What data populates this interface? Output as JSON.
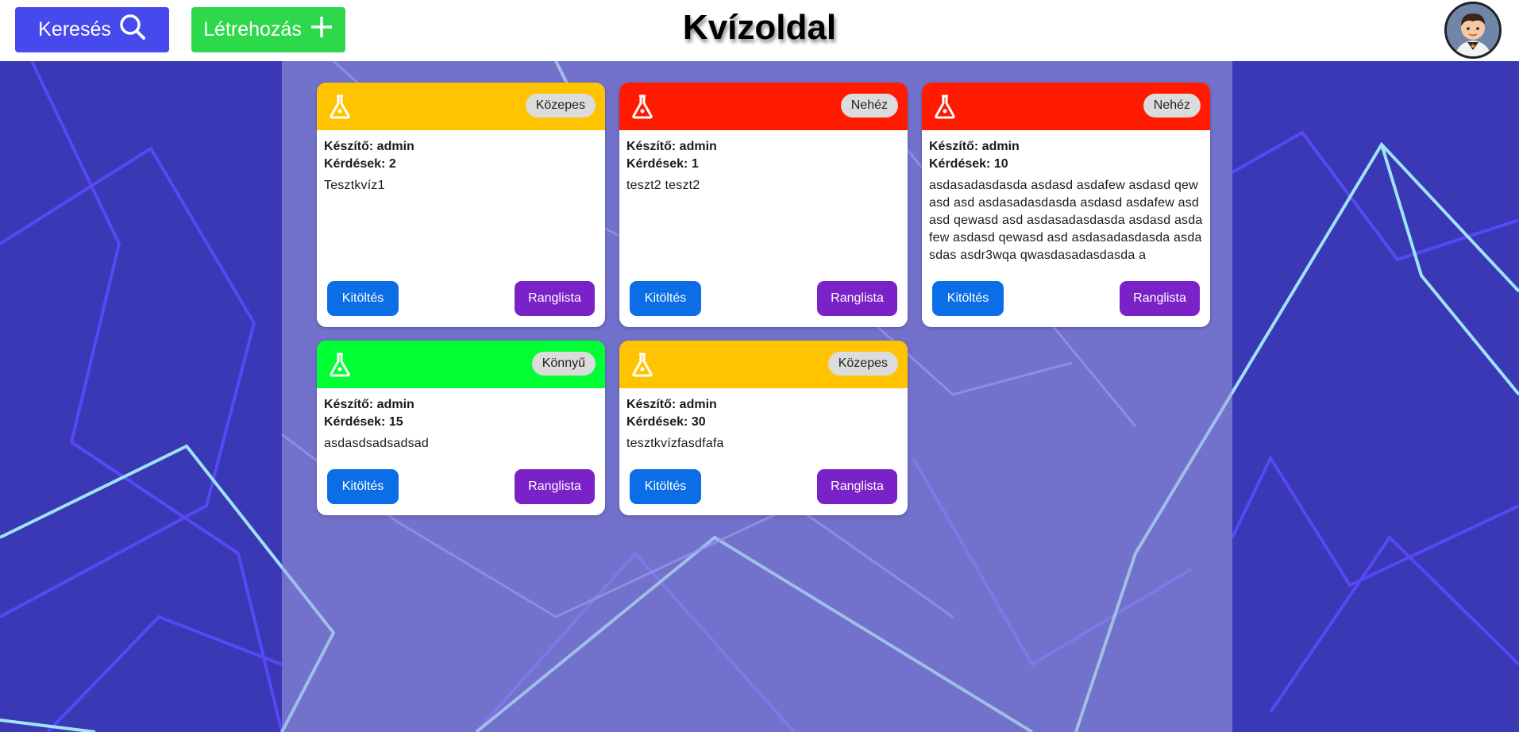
{
  "header": {
    "search_label": "Keresés",
    "create_label": "Létrehozás",
    "title": "Kvízoldal"
  },
  "colors": {
    "search": "#4649ec",
    "create": "#2dd84a",
    "medium": "#ffc300",
    "hard": "#ff1a00",
    "easy": "#00ff33",
    "fill_button": "#0b6ee6",
    "rank_button": "#7a22c8"
  },
  "cards": [
    {
      "difficulty": "Közepes",
      "creator": "Készítő: admin",
      "questions": "Kérdések: 2",
      "description": "Tesztkvíz1",
      "fill_label": "Kitöltés",
      "rank_label": "Ranglista"
    },
    {
      "difficulty": "Nehéz",
      "creator": "Készítő: admin",
      "questions": "Kérdések: 1",
      "description": "teszt2 teszt2",
      "fill_label": "Kitöltés",
      "rank_label": "Ranglista"
    },
    {
      "difficulty": "Nehéz",
      "creator": "Készítő: admin",
      "questions": "Kérdések: 10",
      "description": "asdasadasdasda asdasd asdafew asdasd qewasd asd asdasadasdasda asdasd asdafew asdasd qewasd asd asdasadasdasda asdasd asdafew asdasd qewasd asd asdasadasdasda asdasdas asdr3wqa qwasdasadasdasda a",
      "fill_label": "Kitöltés",
      "rank_label": "Ranglista"
    },
    {
      "difficulty": "Könnyű",
      "creator": "Készítő: admin",
      "questions": "Kérdések: 15",
      "description": "asdasdsadsadsad",
      "fill_label": "Kitöltés",
      "rank_label": "Ranglista"
    },
    {
      "difficulty": "Közepes",
      "creator": "Készítő: admin",
      "questions": "Kérdések: 30",
      "description": "tesztkvízfasdfafa",
      "fill_label": "Kitöltés",
      "rank_label": "Ranglista"
    }
  ]
}
